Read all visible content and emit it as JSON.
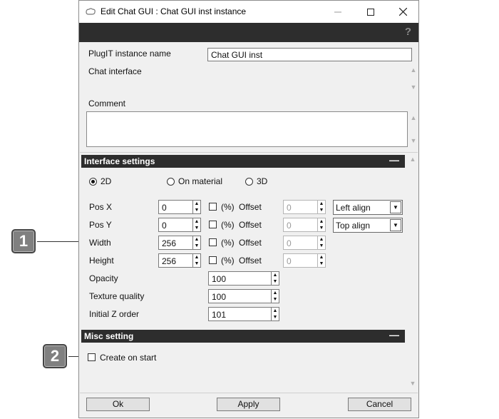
{
  "window": {
    "title": "Edit Chat GUI : Chat GUI inst instance",
    "help_icon": "?"
  },
  "form": {
    "instance_name_label": "PlugIT instance name",
    "instance_name_value": "Chat GUI inst",
    "chat_interface_label": "Chat interface",
    "comment_label": "Comment"
  },
  "interface_settings": {
    "header": "Interface settings",
    "collapse": "—",
    "modes": [
      "2D",
      "On material",
      "3D"
    ],
    "selected_mode": "2D",
    "rows": [
      {
        "label": "Pos X",
        "value": "0",
        "pct": "(%)",
        "offset_label": "Offset",
        "offset_value": "0",
        "align": "Left align"
      },
      {
        "label": "Pos Y",
        "value": "0",
        "pct": "(%)",
        "offset_label": "Offset",
        "offset_value": "0",
        "align": "Top align"
      },
      {
        "label": "Width",
        "value": "256",
        "pct": "(%)",
        "offset_label": "Offset",
        "offset_value": "0"
      },
      {
        "label": "Height",
        "value": "256",
        "pct": "(%)",
        "offset_label": "Offset",
        "offset_value": "0"
      }
    ],
    "opacity_label": "Opacity",
    "opacity_value": "100",
    "texture_label": "Texture quality",
    "texture_value": "100",
    "zorder_label": "Initial Z order",
    "zorder_value": "101"
  },
  "misc_settings": {
    "header": "Misc setting",
    "collapse": "—",
    "create_on_start": "Create on start"
  },
  "buttons": {
    "ok": "Ok",
    "apply": "Apply",
    "cancel": "Cancel"
  },
  "callouts": [
    "1",
    "2"
  ]
}
